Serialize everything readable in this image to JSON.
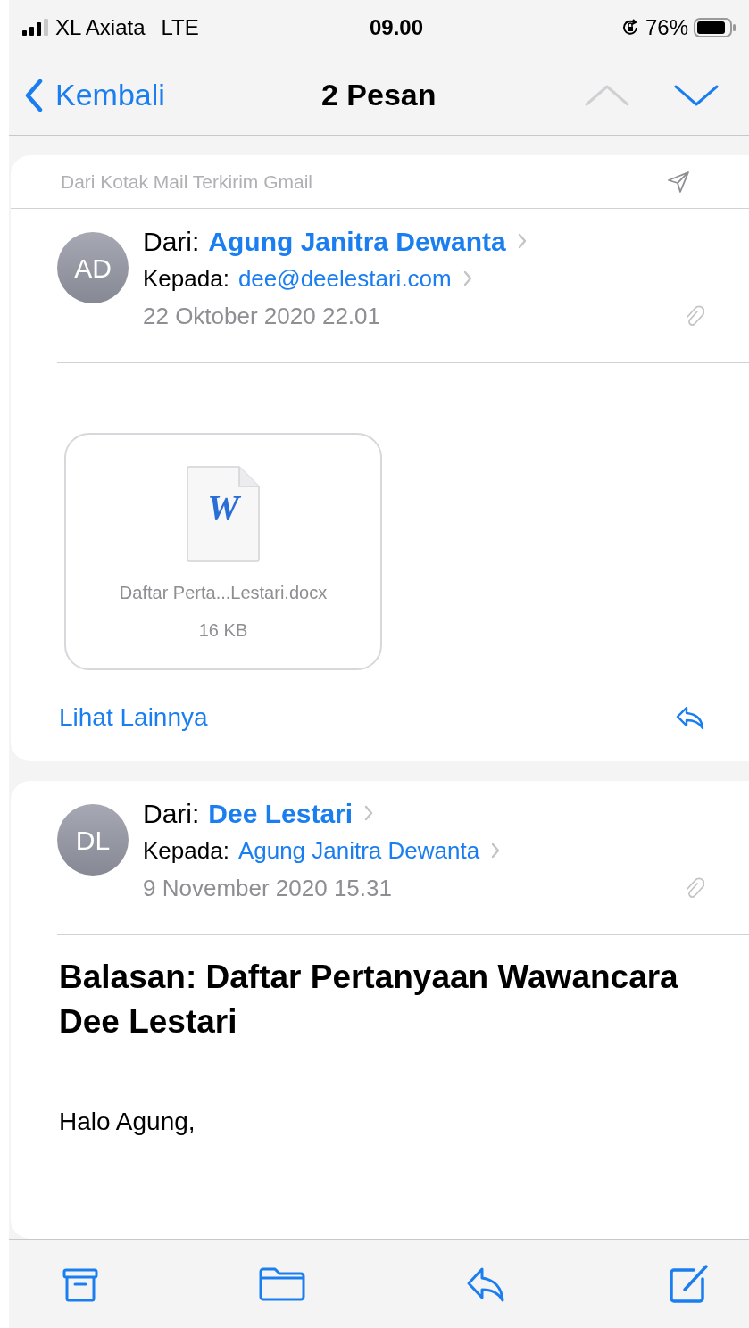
{
  "status_bar": {
    "carrier": "XL Axiata",
    "network": "LTE",
    "time": "09.00",
    "battery": "76%"
  },
  "nav": {
    "back": "Kembali",
    "title": "2 Pesan",
    "previous": {
      "disabled": true
    },
    "next": {
      "disabled": false
    }
  },
  "messages": [
    {
      "mailbox_note": "Dari Kotak Mail Terkirim Gmail",
      "initials": "AD",
      "from_label": "Dari:",
      "from": "Agung Janitra Dewanta",
      "to_label": "Kepada:",
      "to": "dee@deelestari.com",
      "date": "22 Oktober 2020 22.01",
      "attachment": {
        "name": "Daftar Perta...Lestari.docx",
        "size": "16 KB",
        "type_letter": "W"
      },
      "more_link": "Lihat Lainnya"
    },
    {
      "initials": "DL",
      "from_label": "Dari:",
      "from": "Dee Lestari",
      "to_label": "Kepada:",
      "to": "Agung Janitra Dewanta",
      "date": "9 November 2020 15.31",
      "subject": "Balasan: Daftar Pertanyaan Wawancara Dee Lestari",
      "body": "Halo Agung,"
    }
  ]
}
